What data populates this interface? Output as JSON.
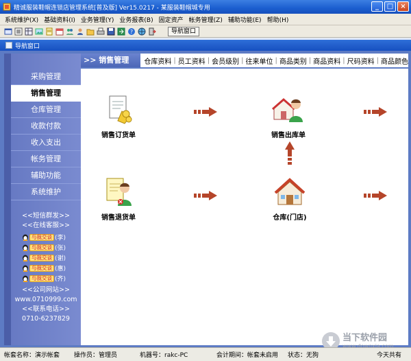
{
  "window": {
    "title": "精诚服装鞋帽连锁店管理系统[普及版] Ver15.0217 - 某服装鞋帽城专用"
  },
  "menubar": [
    "系统维护(X)",
    "基础资料(I)",
    "业务管理(Y)",
    "业务报表(B)",
    "固定资产",
    "帐务管理(Z)",
    "辅助功能(E)",
    "帮助(H)"
  ],
  "toolbar": {
    "nav_button": "导航窗口"
  },
  "subwindow": {
    "title": "导航窗口"
  },
  "sidebar": {
    "items": [
      "采购管理",
      "销售管理",
      "仓库管理",
      "收款付款",
      "收入支出",
      "帐务管理",
      "辅助功能",
      "系统维护"
    ],
    "active_index": 1,
    "sms_link": "<<短信群发>>",
    "support_link": "<<在线客服>>",
    "qq_button": "与我交谈",
    "qq_contacts": [
      "(李)",
      "(张)",
      "(谢)",
      "(惠)",
      "(齐)"
    ],
    "website_label": "<<公司网站>>",
    "website_url": "www.0710999.com",
    "phone_label": "<<联系电话>>",
    "phone": "0710-6237829"
  },
  "main": {
    "section_title": ">> 销售管理",
    "tabs": [
      "仓库资料",
      "员工资料",
      "会员级别",
      "往来单位",
      "商品类别",
      "商品资料",
      "尺码资料",
      "商品颜色"
    ],
    "flow": {
      "sales_order": "销售订货单",
      "sales_outbound": "销售出库单",
      "sales_return": "销售退货单",
      "warehouse": "仓库(门店)"
    }
  },
  "status": {
    "account": "帐套名称：演示帐套",
    "operator": "操作员：管理员",
    "machine": "机器号：rakc-PC",
    "period": "会计期间：帐套未启用",
    "state": "状态：无狗",
    "today": "今天共有"
  },
  "watermark": {
    "name": "当下软件园",
    "url": "www.downxia.com"
  },
  "colors": {
    "sidebar": "#6a7fc8",
    "header_blue": "#5d7bc4",
    "arrow": "#b5452a"
  }
}
